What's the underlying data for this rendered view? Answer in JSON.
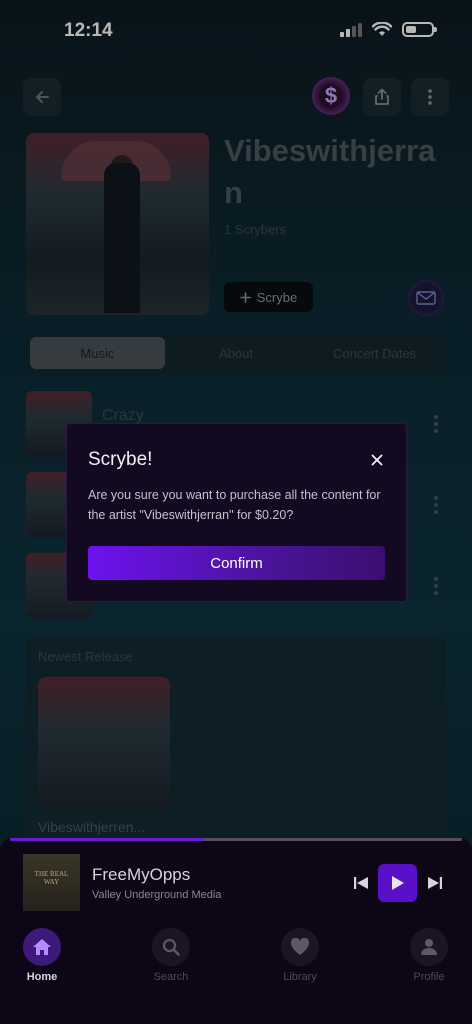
{
  "status_bar": {
    "time": "12:14"
  },
  "artist": {
    "name": "Vibeswithjerran",
    "subscribers": "1 Scrybers",
    "scrybe_button": "Scrybe"
  },
  "tabs": [
    {
      "label": "Music",
      "active": true
    },
    {
      "label": "About",
      "active": false
    },
    {
      "label": "Concert Dates",
      "active": false
    }
  ],
  "tracks": [
    {
      "title": "Crazy"
    },
    {
      "title": ""
    },
    {
      "title": ""
    }
  ],
  "newest_release": {
    "label": "Newest Release",
    "title": "Vibeswithjerren..."
  },
  "modal": {
    "title": "Scrybe!",
    "body": "Are you sure you want to purchase all the content for the artist \"Vibeswithjerran\" for $0.20?",
    "confirm_label": "Confirm"
  },
  "player": {
    "song": "FreeMyOpps",
    "artist": "Valley Underground Media",
    "art_text": "THE REAL WAY",
    "progress": 0.43
  },
  "nav": [
    {
      "label": "Home",
      "icon": "home-icon",
      "active": true
    },
    {
      "label": "Search",
      "icon": "search-icon",
      "active": false
    },
    {
      "label": "Library",
      "icon": "heart-icon",
      "active": false
    },
    {
      "label": "Profile",
      "icon": "profile-icon",
      "active": false
    }
  ],
  "colors": {
    "accent": "#6d12f0",
    "modal_bg": "#130a22"
  }
}
